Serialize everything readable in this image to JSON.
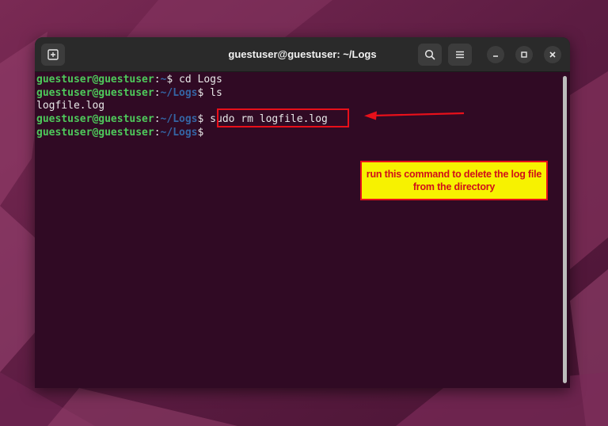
{
  "window": {
    "title": "guestuser@guestuser: ~/Logs"
  },
  "terminal": {
    "lines": [
      {
        "user": "guestuser@guestuser",
        "colon": ":",
        "path": "~",
        "dollar": "$",
        "command": " cd Logs"
      },
      {
        "user": "guestuser@guestuser",
        "colon": ":",
        "path": "~/Logs",
        "dollar": "$",
        "command": " ls"
      },
      {
        "output": "logfile.log"
      },
      {
        "user": "guestuser@guestuser",
        "colon": ":",
        "path": "~/Logs",
        "dollar": "$",
        "command": " sudo rm logfile.log"
      },
      {
        "user": "guestuser@guestuser",
        "colon": ":",
        "path": "~/Logs",
        "dollar": "$",
        "command": ""
      }
    ]
  },
  "annotation": {
    "note_text": "run this command to delete the log file from the directory"
  },
  "colors": {
    "terminal_bg": "#300a24",
    "prompt_user": "#4ec95b",
    "prompt_path": "#3465a4",
    "annotation_red": "#e8101a",
    "annotation_yellow": "#f7f200"
  }
}
